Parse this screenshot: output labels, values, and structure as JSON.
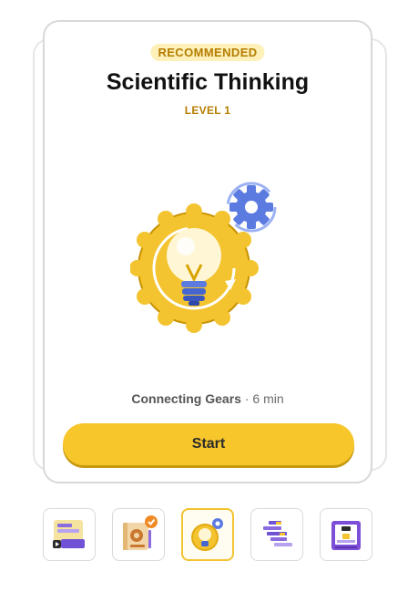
{
  "card": {
    "badge": "RECOMMENDED",
    "title": "Scientific Thinking",
    "level": "LEVEL 1",
    "illustration_icon": "lightbulb-gear-icon",
    "lesson_name": "Connecting Gears",
    "lesson_sep": " · ",
    "lesson_duration": "6 min",
    "start_label": "Start"
  },
  "thumbnails": [
    {
      "icon": "video-slides-icon",
      "active": false
    },
    {
      "icon": "notebook-completed-icon",
      "completed": true,
      "active": false
    },
    {
      "icon": "lightbulb-gear-icon",
      "active": true
    },
    {
      "icon": "blocks-chart-icon",
      "active": false
    },
    {
      "icon": "3d-printer-icon",
      "active": false
    }
  ],
  "colors": {
    "accent": "#f7c62b",
    "badge_bg": "#fdf0b8",
    "badge_text": "#b57d00",
    "gear_blue": "#5b7be0"
  }
}
